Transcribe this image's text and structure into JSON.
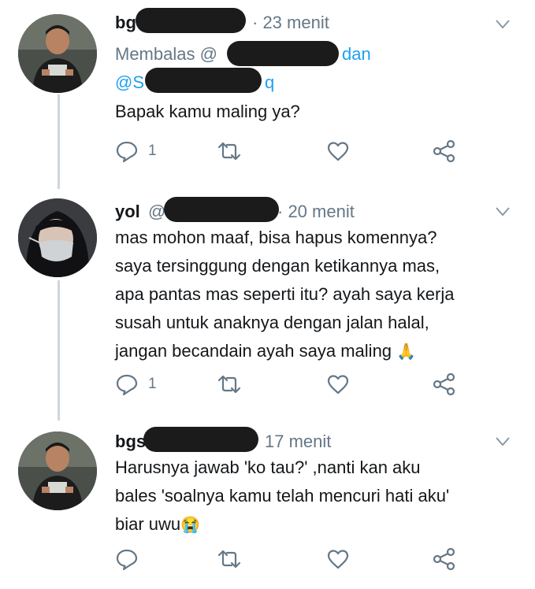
{
  "tweets": [
    {
      "name": "bg",
      "time": "· 23 menit",
      "reply_prefix": "Membalas @",
      "reply_dan": "dan",
      "reply_second_prefix": "@S",
      "reply_second_suffix": "q",
      "text": "Bapak kamu maling ya?",
      "reply_count": "1",
      "avatar_icon": "person-photo-icon"
    },
    {
      "name": "yol",
      "handle_prefix": "@",
      "time": "· 20 menit",
      "text": "mas mohon maaf, bisa hapus komennya?\nsaya tersinggung dengan ketikannya mas,\napa pantas mas seperti itu? ayah saya kerja\nsusah untuk anaknya dengan jalan halal,\njangan becandain ayah saya maling",
      "emoji": "🙏",
      "reply_count": "1",
      "avatar_icon": "masked-person-photo-icon"
    },
    {
      "name": "bg",
      "name_suffix": "s",
      "time": "17 menit",
      "text": "Harusnya jawab 'ko tau?' ,nanti kan aku\nbales 'soalnya kamu telah mencuri hati aku'\nbiar uwu",
      "emoji": "😭",
      "reply_count": "",
      "avatar_icon": "person-photo-icon"
    }
  ],
  "colors": {
    "text": "#14171a",
    "muted": "#657786",
    "link": "#1da1f2",
    "thread_line": "#ccd6dd",
    "redaction": "#1b1b1c"
  }
}
